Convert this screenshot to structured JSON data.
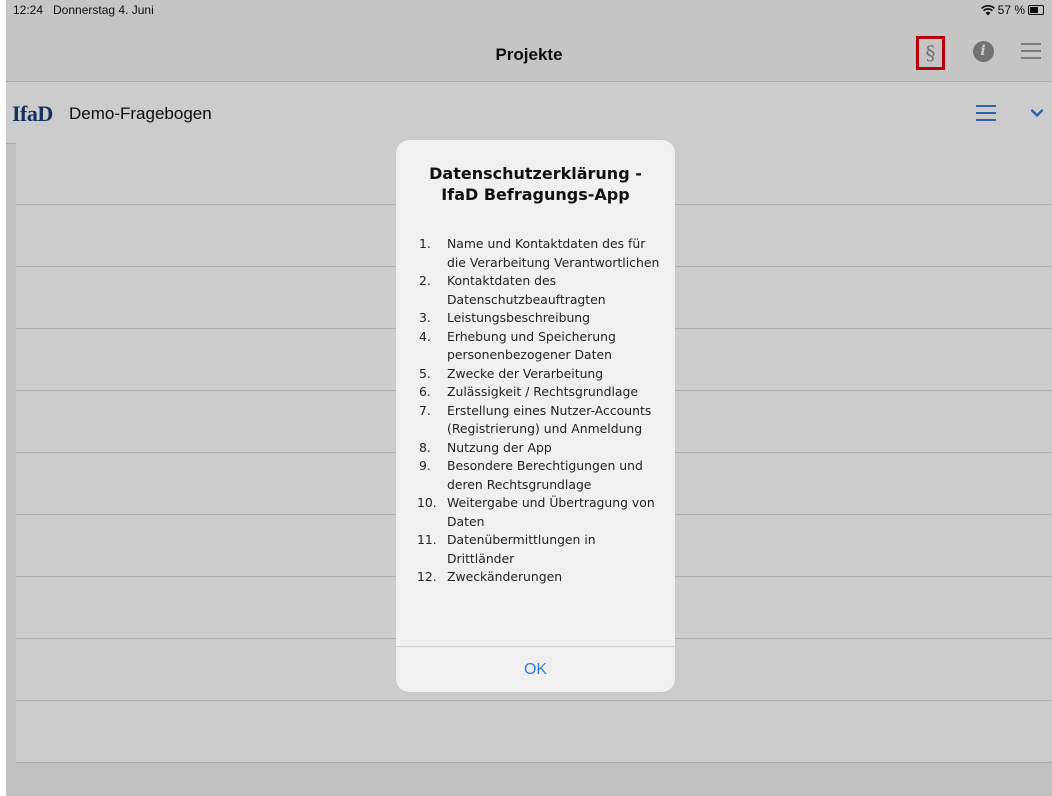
{
  "status_bar": {
    "time": "12:24",
    "date": "Donnerstag 4. Juni",
    "battery": "57 %",
    "wifi_icon": "wifi-icon"
  },
  "nav_bar": {
    "title": "Projekte",
    "paragraph_label": "§",
    "info_label": "i"
  },
  "project": {
    "logo": "IfaD",
    "name": "Demo-Fragebogen"
  },
  "dialog": {
    "title": "Datenschutzerklärung - IfaD Befragungs-App",
    "items": [
      {
        "num": "1.",
        "text": "Name und Kontaktdaten des für die Verarbeitung Verantwortlichen"
      },
      {
        "num": "2.",
        "text": "Kontaktdaten des Datenschutzbeauftragten"
      },
      {
        "num": "3.",
        "text": "Leistungsbeschreibung"
      },
      {
        "num": "4.",
        "text": "Erhebung und Speicherung personenbezogener Daten"
      },
      {
        "num": "5.",
        "text": "Zwecke der Verarbeitung"
      },
      {
        "num": "6.",
        "text": "Zulässigkeit / Rechtsgrundlage"
      },
      {
        "num": "7.",
        "text": "Erstellung eines Nutzer-Accounts (Registrierung) und Anmeldung"
      },
      {
        "num": "8.",
        "text": "Nutzung der App"
      },
      {
        "num": "9.",
        "text": "Besondere Berechtigungen und deren Rechtsgrundlage"
      },
      {
        "num": "10.",
        "text": "Weitergabe und Übertragung von Daten"
      },
      {
        "num": "11.",
        "text": "Datenübermittlungen in Drittländer"
      },
      {
        "num": "12.",
        "text": "Zweckänderungen"
      }
    ],
    "ok_label": "OK"
  },
  "colors": {
    "highlight": "#e3000f",
    "accent": "#2f7ae5",
    "logo": "#1b3e7a"
  }
}
